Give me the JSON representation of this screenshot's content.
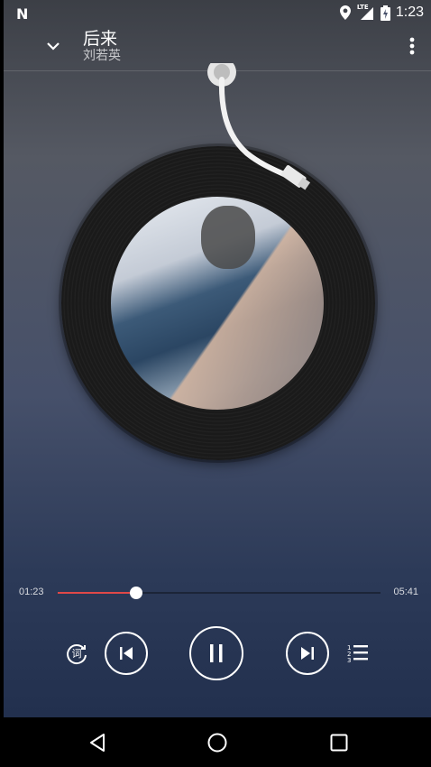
{
  "status_bar": {
    "time": "1:23",
    "network": "LTE"
  },
  "song": {
    "title": "后来",
    "artist": "刘若英"
  },
  "progress": {
    "current": "01:23",
    "total": "05:41",
    "fraction": 0.243
  },
  "controls": {
    "lyric_label": "词"
  },
  "colors": {
    "accent": "#e04848",
    "text": "#ffffff"
  }
}
